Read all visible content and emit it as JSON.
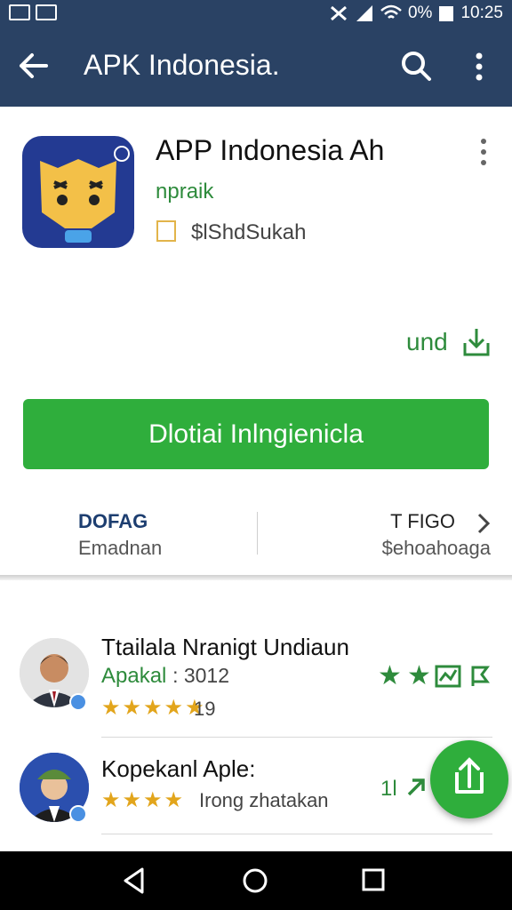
{
  "status_bar": {
    "battery": "0%",
    "time": "10:25"
  },
  "app_bar": {
    "title": "APK Indonesia."
  },
  "app": {
    "name": "APP Indonesia Ah",
    "developer": "npraik",
    "category": "$lShdSukah",
    "size_label": "und"
  },
  "install_button": {
    "label": "Dlotiai Inlngienicla"
  },
  "info": {
    "left_title": "DOFAG",
    "left_sub": "Emadnan",
    "right_title": "T FIGO",
    "right_sub": "$ehoahoaga"
  },
  "reviews": [
    {
      "name": "Ttailala Nranigt Undiaun",
      "sub": "Apakal",
      "number": ": 3012",
      "stars": "★★★★★",
      "count": "19"
    },
    {
      "name": "Kopekanl Aple:",
      "stars": "★★★★",
      "count": "Irong zhatakan",
      "side_num": "1l"
    }
  ],
  "colors": {
    "header": "#2a4264",
    "accent_green": "#2fae3c",
    "star_gold": "#e2a51c"
  },
  "icons": [
    "back-arrow-icon",
    "search-icon",
    "more-vert-icon",
    "download-icon",
    "chevron-right-icon",
    "share-icon",
    "nav-back-icon",
    "nav-home-icon",
    "nav-recents-icon"
  ]
}
